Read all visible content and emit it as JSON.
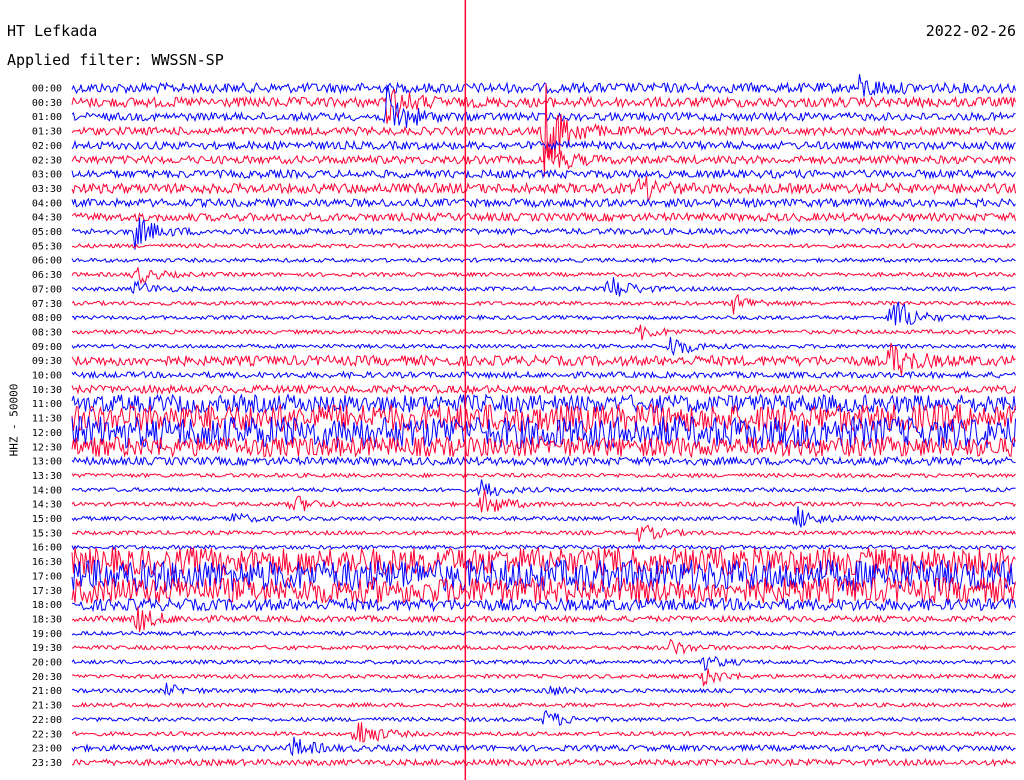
{
  "header": {
    "station": "HT Lefkada",
    "date": "2022-02-26",
    "filter": "Applied filter: WWSSN-SP"
  },
  "colors": {
    "trace_a": "#0000ff",
    "trace_b": "#ff0033",
    "marker": "#ff0033"
  },
  "chart_data": {
    "type": "line",
    "title": "HT Lefkada",
    "ylabel": "HHZ - 50000",
    "grid": false,
    "legend": "none",
    "row_labels": [
      "00:00",
      "00:30",
      "01:00",
      "01:30",
      "02:00",
      "02:30",
      "03:00",
      "03:30",
      "04:00",
      "04:30",
      "05:00",
      "05:30",
      "06:00",
      "06:30",
      "07:00",
      "07:30",
      "08:00",
      "08:30",
      "09:00",
      "09:30",
      "10:00",
      "10:30",
      "11:00",
      "11:30",
      "12:00",
      "12:30",
      "13:00",
      "13:30",
      "14:00",
      "14:30",
      "15:00",
      "15:30",
      "16:00",
      "16:30",
      "17:00",
      "17:30",
      "18:00",
      "18:30",
      "19:00",
      "19:30",
      "20:00",
      "20:30",
      "21:00",
      "21:30",
      "22:00",
      "22:30",
      "23:00",
      "23:30"
    ],
    "row_colors": [
      "blue",
      "red"
    ],
    "row_noise": [
      5,
      5,
      4,
      4,
      4,
      4,
      4,
      5,
      4,
      4,
      3,
      2,
      2,
      2,
      2,
      2,
      2,
      2,
      2,
      5,
      3,
      4,
      9,
      14,
      16,
      10,
      4,
      2,
      2,
      2,
      2,
      2,
      2,
      14,
      16,
      13,
      6,
      3,
      2,
      2,
      2,
      2,
      2,
      2,
      2,
      2,
      3,
      3
    ],
    "events": [
      {
        "row": 0,
        "minute": 25,
        "amp": 10
      },
      {
        "row": 1,
        "minute": 10,
        "amp": 20
      },
      {
        "row": 2,
        "minute": 10,
        "amp": 28
      },
      {
        "row": 3,
        "minute": 15,
        "amp": 50
      },
      {
        "row": 5,
        "minute": 15,
        "amp": 18
      },
      {
        "row": 7,
        "minute": 18,
        "amp": 12
      },
      {
        "row": 10,
        "minute": 2,
        "amp": 16
      },
      {
        "row": 13,
        "minute": 2,
        "amp": 10
      },
      {
        "row": 14,
        "minute": 2,
        "amp": 8
      },
      {
        "row": 14,
        "minute": 17,
        "amp": 16
      },
      {
        "row": 15,
        "minute": 21,
        "amp": 10
      },
      {
        "row": 16,
        "minute": 26,
        "amp": 26
      },
      {
        "row": 17,
        "minute": 18,
        "amp": 8
      },
      {
        "row": 18,
        "minute": 19,
        "amp": 12
      },
      {
        "row": 19,
        "minute": 26,
        "amp": 20
      },
      {
        "row": 28,
        "minute": 13,
        "amp": 10
      },
      {
        "row": 29,
        "minute": 7,
        "amp": 10
      },
      {
        "row": 29,
        "minute": 13,
        "amp": 16
      },
      {
        "row": 30,
        "minute": 5,
        "amp": 6
      },
      {
        "row": 30,
        "minute": 23,
        "amp": 12
      },
      {
        "row": 31,
        "minute": 18,
        "amp": 10
      },
      {
        "row": 37,
        "minute": 2,
        "amp": 14
      },
      {
        "row": 39,
        "minute": 19,
        "amp": 8
      },
      {
        "row": 40,
        "minute": 20,
        "amp": 8
      },
      {
        "row": 41,
        "minute": 20,
        "amp": 10
      },
      {
        "row": 42,
        "minute": 3,
        "amp": 6
      },
      {
        "row": 42,
        "minute": 15,
        "amp": 6
      },
      {
        "row": 44,
        "minute": 15,
        "amp": 10
      },
      {
        "row": 45,
        "minute": 9,
        "amp": 18
      },
      {
        "row": 46,
        "minute": 7,
        "amp": 10
      }
    ],
    "marker_minute": 12.5
  }
}
